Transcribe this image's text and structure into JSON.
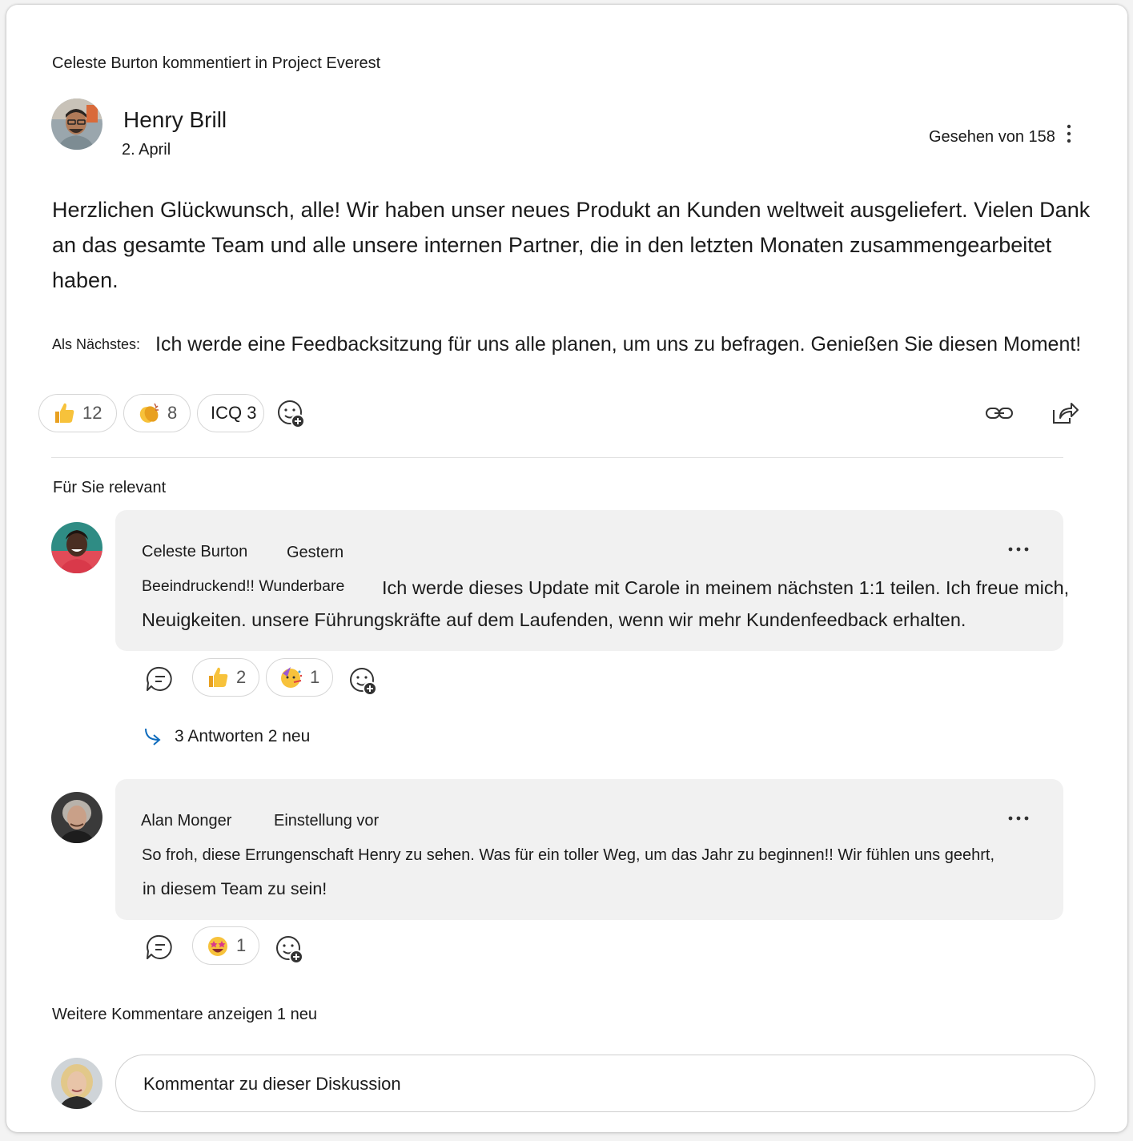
{
  "post": {
    "context": "Celeste Burton kommentiert in Project Everest",
    "author": "Henry Brill",
    "date": "2. April",
    "seen_by": "Gesehen von 158",
    "body": "Herzlichen Glückwunsch, alle! Wir haben unser neues Produkt an Kunden weltweit ausgeliefert. Vielen Dank an das gesamte Team und alle unsere internen Partner, die in den letzten Monaten zusammengearbeitet haben.",
    "next_label": "Als Nächstes:",
    "next_text": "Ich werde eine Feedbacksitzung für uns alle planen, um uns zu befragen. Genießen Sie diesen Moment!",
    "reactions": [
      {
        "icon": "thumbs-up",
        "count": "12"
      },
      {
        "icon": "clapping-hands",
        "count": "8"
      },
      {
        "icon": "",
        "label": "ICQ",
        "count": "3"
      }
    ]
  },
  "section_title": "Für Sie relevant",
  "comments": [
    {
      "author": "Celeste Burton",
      "time": "Gestern",
      "text_part1": "Beeindruckend!! Wunderbare",
      "text_part2": "Ich werde dieses Update mit Carole in meinem nächsten 1:1 teilen. Ich freue mich,",
      "text_line2": "Neuigkeiten. unsere Führungskräfte auf dem Laufenden, wenn wir mehr Kundenfeedback erhalten.",
      "reactions": [
        {
          "icon": "thumbs-up",
          "count": "2"
        },
        {
          "icon": "party-face",
          "count": "1"
        }
      ],
      "replies": "3 Antworten 2 neu"
    },
    {
      "author": "Alan Monger",
      "time": "Einstellung vor",
      "text_line1": "So froh, diese Errungenschaft Henry zu sehen. Was für ein toller Weg, um das Jahr zu beginnen!! Wir fühlen uns geehrt,",
      "text_line2": "in diesem Team zu sein!",
      "reactions": [
        {
          "icon": "star-struck-face",
          "count": "1"
        }
      ]
    }
  ],
  "more_comments": "Weitere Kommentare anzeigen 1 neu",
  "compose": {
    "placeholder": "Kommentar zu dieser Diskussion"
  },
  "colors": {
    "link_arrow": "#0f6cbd",
    "bubble_bg": "#f1f1f1",
    "pill_border": "#d6d6d6"
  }
}
